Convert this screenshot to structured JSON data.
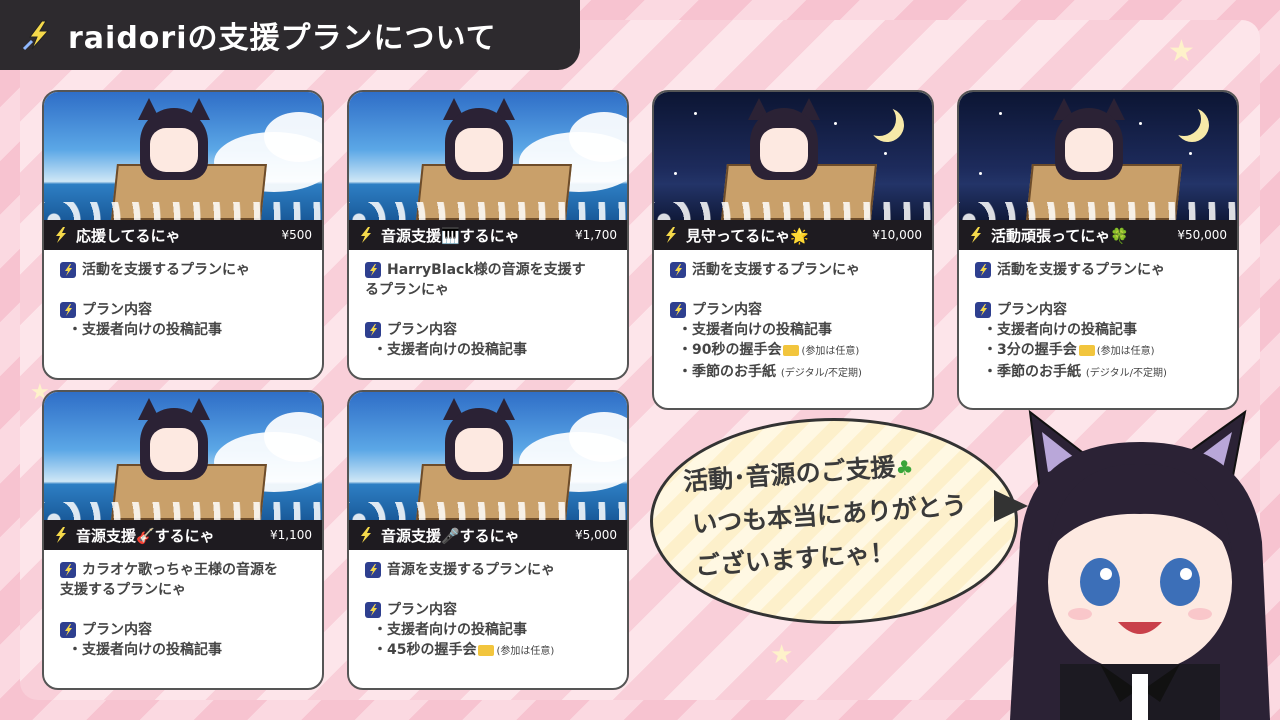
{
  "header": {
    "title": "raidoriの支援プランについて"
  },
  "cards": [
    {
      "plan_name": "応援してるにゃ",
      "price": "¥500",
      "scene": "day",
      "description": "活動を支援するプランにゃ",
      "desc_line2": "",
      "content_heading": "プラン内容",
      "items": [
        "・支援者向けの投稿記事"
      ]
    },
    {
      "plan_name": "音源支援🎹するにゃ",
      "price": "¥1,700",
      "scene": "day",
      "description": "HarryBlack様の音源を支援す",
      "desc_line2": "るプランにゃ",
      "content_heading": "プラン内容",
      "items": [
        "・支援者向けの投稿記事"
      ]
    },
    {
      "plan_name": "見守ってるにゃ🌟",
      "price": "¥10,000",
      "scene": "night",
      "description": "活動を支援するプランにゃ",
      "desc_line2": "",
      "content_heading": "プラン内容",
      "items": [
        "・支援者向けの投稿記事",
        "・90秒の握手会",
        "・季節のお手紙"
      ],
      "item_notes": [
        "",
        "(参加は任意)",
        "(デジタル/不定期)"
      ]
    },
    {
      "plan_name": "活動頑張ってにゃ🍀",
      "price": "¥50,000",
      "scene": "night",
      "description": "活動を支援するプランにゃ",
      "desc_line2": "",
      "content_heading": "プラン内容",
      "items": [
        "・支援者向けの投稿記事",
        "・3分の握手会",
        "・季節のお手紙"
      ],
      "item_notes": [
        "",
        "(参加は任意)",
        "(デジタル/不定期)"
      ]
    },
    {
      "plan_name": "音源支援🎸するにゃ",
      "price": "¥1,100",
      "scene": "day",
      "description": "カラオケ歌っちゃ王様の音源を",
      "desc_line2": "支援するプランにゃ",
      "content_heading": "プラン内容",
      "items": [
        "・支援者向けの投稿記事"
      ]
    },
    {
      "plan_name": "音源支援🎤するにゃ",
      "price": "¥5,000",
      "scene": "day",
      "description": "音源を支援するプランにゃ",
      "desc_line2": "",
      "content_heading": "プラン内容",
      "items": [
        "・支援者向けの投稿記事",
        "・45秒の握手会"
      ],
      "item_notes": [
        "",
        "(参加は任意)"
      ]
    }
  ],
  "speech": {
    "line1": "活動･音源のご支援",
    "line2": "いつも本当にありがとう",
    "line3": "ございますにゃ！"
  },
  "colors": {
    "accent_dark": "#1e1b20",
    "stripe_pink": "#f7c3d0",
    "bubble_cream": "#fdf0cb"
  }
}
